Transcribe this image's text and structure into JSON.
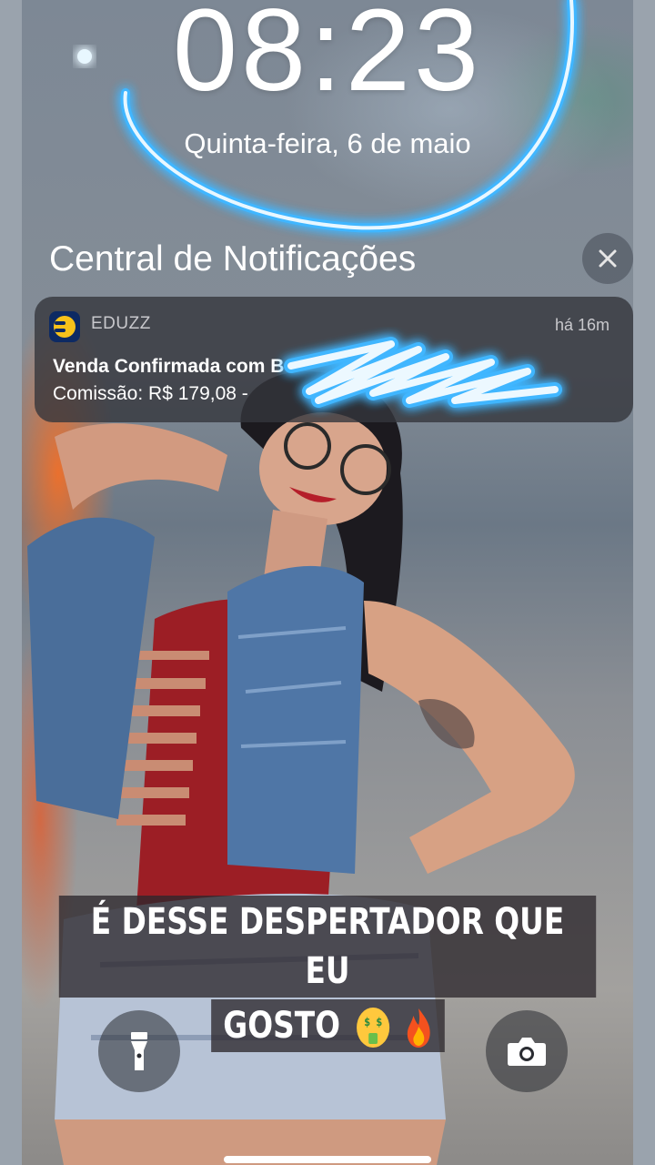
{
  "lockscreen": {
    "time": "08:23",
    "date": "Quinta-feira, 6 de maio"
  },
  "notification_center": {
    "title": "Central de Notificações",
    "close_icon": "close-icon"
  },
  "notification": {
    "app_name": "EDUZZ",
    "app_icon": "eduzz-logo-icon",
    "time": "há 16m",
    "title": "Venda Confirmada com Bo",
    "body": "Comissão: R$ 179,08 -"
  },
  "story": {
    "caption_line1": "É DESSE DESPERTADOR QUE EU",
    "caption_line2": "GOSTO",
    "emoji": [
      "money-mouth-face-icon",
      "fire-icon"
    ]
  },
  "quick_actions": {
    "left": "flashlight-icon",
    "right": "camera-icon"
  },
  "colors": {
    "neon": "#3fb6ff",
    "notification_bg": "#34363c",
    "caption_bg": "#2d282d"
  }
}
